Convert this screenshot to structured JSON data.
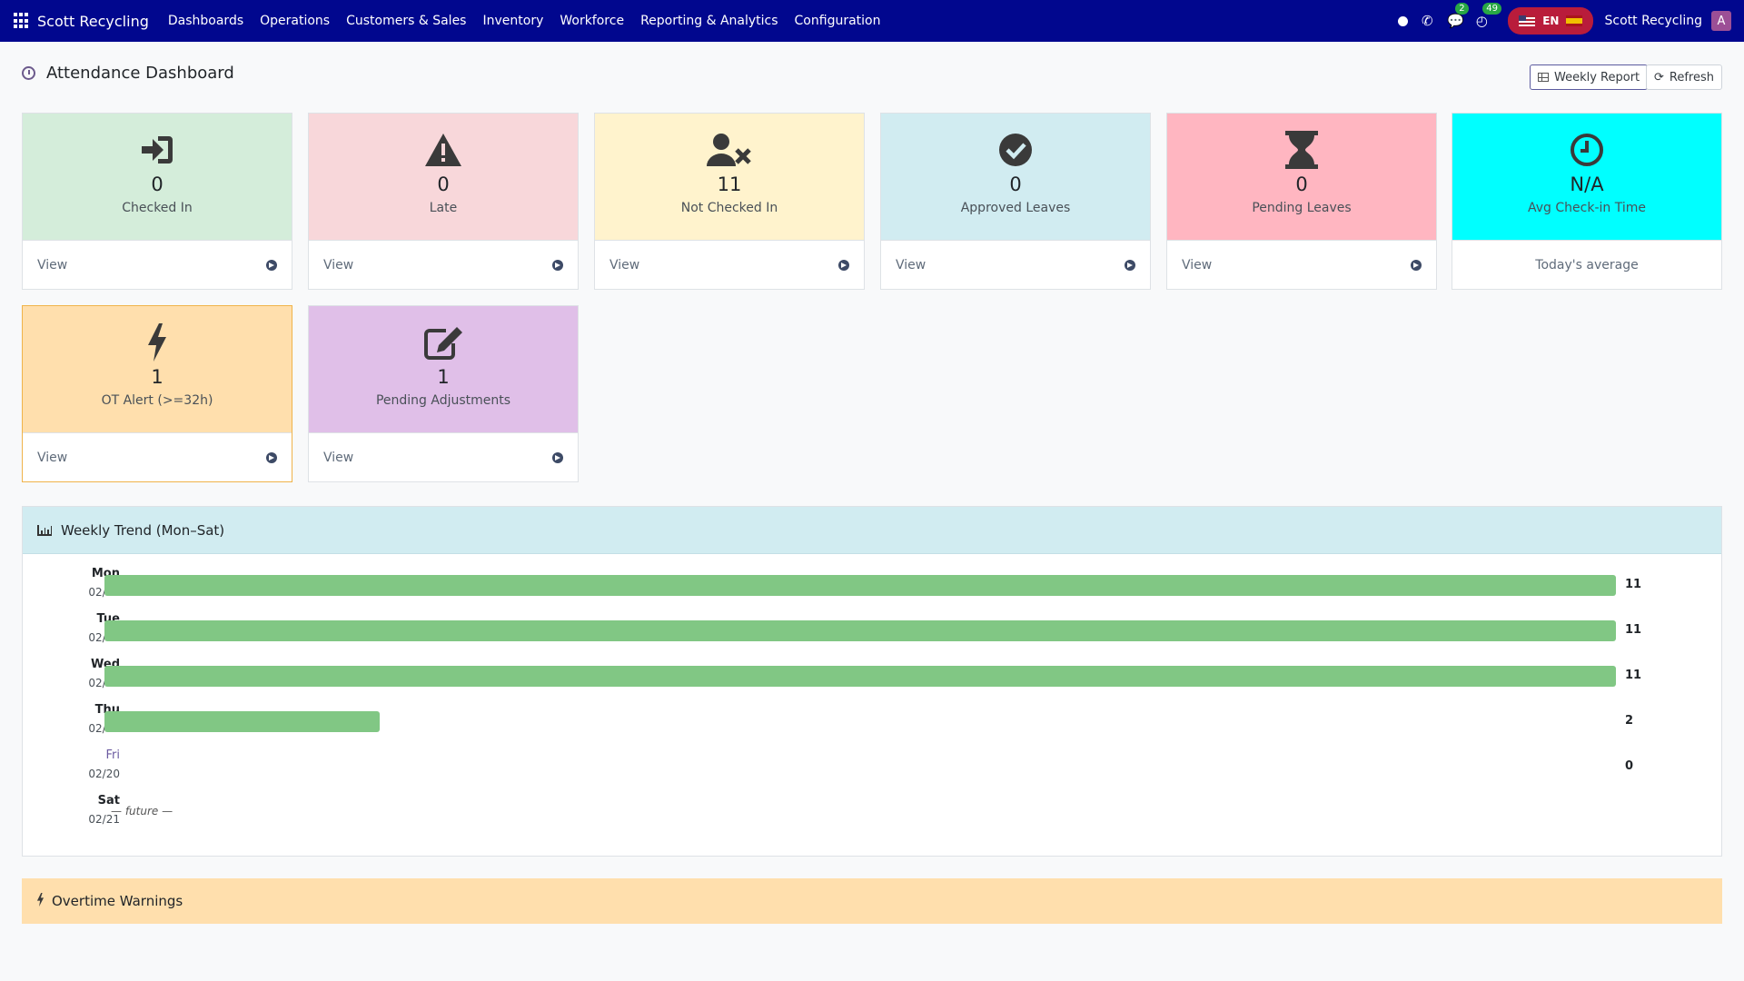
{
  "navbar": {
    "brand": "Scott Recycling",
    "menu": [
      "Dashboards",
      "Operations",
      "Customers & Sales",
      "Inventory",
      "Workforce",
      "Reporting & Analytics",
      "Configuration"
    ],
    "messages_badge": "2",
    "activity_badge": "49",
    "lang": "EN",
    "company": "Scott Recycling",
    "avatar_letter": "A"
  },
  "page": {
    "title": "Attendance Dashboard",
    "weekly_report_label": "Weekly Report",
    "refresh_label": "Refresh"
  },
  "cards": [
    {
      "value": "0",
      "label": "Checked In",
      "footer": "View",
      "color": "#d4edda",
      "icon": "sign-in-icon"
    },
    {
      "value": "0",
      "label": "Late",
      "footer": "View",
      "color": "#f8d7da",
      "icon": "warning-icon"
    },
    {
      "value": "11",
      "label": "Not Checked In",
      "footer": "View",
      "color": "#fff3cd",
      "icon": "user-times-icon"
    },
    {
      "value": "0",
      "label": "Approved Leaves",
      "footer": "View",
      "color": "#d1ecf1",
      "icon": "check-circle-icon"
    },
    {
      "value": "0",
      "label": "Pending Leaves",
      "footer": "View",
      "color": "#ffb6c1",
      "icon": "hourglass-icon"
    },
    {
      "value": "N/A",
      "label": "Avg Check-in Time",
      "footer": "Today's average",
      "color": "#00ffff",
      "icon": "clock-icon"
    },
    {
      "value": "1",
      "label": "OT Alert (>=32h)",
      "footer": "View",
      "color": "#ffdfad",
      "icon": "bolt-icon"
    },
    {
      "value": "1",
      "label": "Pending Adjustments",
      "footer": "View",
      "color": "#e0bfe8",
      "icon": "edit-icon"
    }
  ],
  "weekly": {
    "title": "Weekly Trend (Mon–Sat)",
    "max": 11,
    "future_label": "— future —",
    "days": [
      {
        "name": "Mon",
        "date": "02/16",
        "count": 11
      },
      {
        "name": "Tue",
        "date": "02/17",
        "count": 11
      },
      {
        "name": "Wed",
        "date": "02/18",
        "count": 11
      },
      {
        "name": "Thu",
        "date": "02/19",
        "count": 2
      },
      {
        "name": "Fri",
        "date": "02/20",
        "count": 0
      },
      {
        "name": "Sat",
        "date": "02/21",
        "count": null
      }
    ]
  },
  "overtime": {
    "title": "Overtime Warnings"
  },
  "colors": {
    "navbar": "#01078e",
    "bar": "#81c784"
  }
}
